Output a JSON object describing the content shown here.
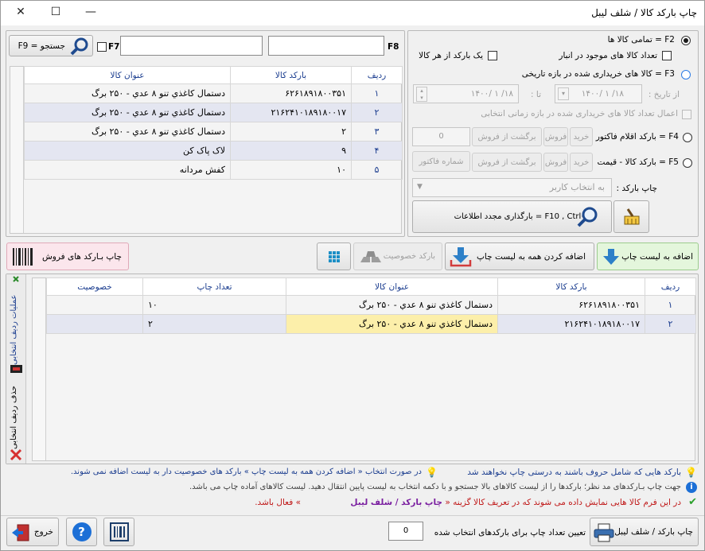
{
  "window": {
    "title": "چاپ بارکد کالا / شلف لیبل"
  },
  "search": {
    "f8_label": "F8",
    "f7_label": "F7",
    "f9_button": "F9 = جستجو",
    "field1_value": "",
    "field2_value": ""
  },
  "top_grid": {
    "headers": [
      "ردیف",
      "بارکد کالا",
      "عنوان کالا"
    ],
    "rows": [
      {
        "idx": "۱",
        "barcode": "۶۲۶۱۸۹۱۸۰۰۳۵۱",
        "title": "دستمال کاغذي تنو ۸ عدي - ۲۵۰ برگ"
      },
      {
        "idx": "۲",
        "barcode": "۲۱۶۲۴۱۰۱۸۹۱۸۰۰۱۷",
        "title": "دستمال کاغذي تنو ۸ عدي - ۲۵۰ برگ"
      },
      {
        "idx": "۳",
        "barcode": "۲",
        "title": "دستمال کاغذي تنو ۸ عدي - ۲۵۰ برگ"
      },
      {
        "idx": "۴",
        "barcode": "۹",
        "title": "لاک پاک کن"
      },
      {
        "idx": "۵",
        "barcode": "۱۰",
        "title": "کفش مردانه"
      }
    ]
  },
  "options": {
    "f2": "F2 = تمامی کالا ها",
    "stock": "تعداد کالا های موجود در انبار",
    "one_per": "یک بارکد از هر کالا",
    "f3": "F3 = کالا های خریداری شده در بازه تاریخی",
    "from_date_label": "از تاریخ :",
    "from_date": "۱۴۰۰/ ۱ /۱۸",
    "to_date_label": "تا :",
    "to_date": "۱۴۰۰/ ۱ /۱۸",
    "apply_count": "اعمال تعداد کالا های خریداری شده در بازه زمانی انتخابی",
    "f4": "F4 = بارکد اقلام فاکتور",
    "f5": "F5 = بارکد کالا - قیمت",
    "buy": "خرید",
    "sell": "فروش",
    "return_sell": "برگشت از فروش",
    "invoice_value": "0",
    "invoice_no": "شماره فاکتور",
    "print_barcode_label": "چاپ بارکد :",
    "user_select": "به انتخاب کاربر",
    "reload": "F10 , Ctrl+F = بارگذاری مجدد اطلاعات"
  },
  "actions": {
    "add_to_list": "اضافه به لیست چاپ",
    "add_all": "اضافه کردن همه به لیست چاپ",
    "special_barcode": "بارکد خصوصیت",
    "print_sales": "چاپ بـارکد های فروش"
  },
  "side": {
    "ops": "عملیات ردیف انتخابی",
    "delete": "حذف ردیف انتخابی"
  },
  "bottom_grid": {
    "headers": [
      "ردیف",
      "بارکد کالا",
      "عنوان کالا",
      "تعداد چاپ",
      "خصوصیت"
    ],
    "rows": [
      {
        "idx": "۱",
        "barcode": "۶۲۶۱۸۹۱۸۰۰۳۵۱",
        "title": "دستمال کاغذي تنو ۸ عدي - ۲۵۰ برگ",
        "count": "۱۰",
        "spec": ""
      },
      {
        "idx": "۲",
        "barcode": "۲۱۶۲۴۱۰۱۸۹۱۸۰۰۱۷",
        "title": "دستمال کاغذي تنو ۸ عدي - ۲۵۰ برگ",
        "count": "۲",
        "spec": ""
      }
    ]
  },
  "hints": {
    "h1": "بارکد هایی که شامل حروف باشند به درستی چاپ نخواهند شد",
    "h1b": "در صورت انتخاب « اضافه کردن همه به لیست چاپ » بارکد های خصوصیت دار به لیست اضافه نمی شوند.",
    "h2": "جهت چاپ بـارکدهای مد نظر؛ بارکدها را از لیست کالاهای بالا جستجو و با دکمه انتخاب به لیست پایین انتقال دهید. لیست کالاهای آماده چاپ می باشد.",
    "h3a": "در این فرم کالا هایی نمایش داده می شوند که در تعریف کالا گزینه «",
    "h3b": "چاپ بارکد / شلف لیبل",
    "h3c": "» فعال باشد."
  },
  "footer": {
    "print": "چاپ بارکد / شلف لیبل",
    "set_count": "تعیین تعداد چاپ برای بارکدهای انتخاب شده",
    "count_value": "0",
    "exit": "خروج"
  },
  "colors": {
    "accent_blue": "#1b3d8f",
    "selected_row": "#e4e6f1",
    "yellow_cell": "#fcefaa",
    "pink_btn": "#fbe6ec",
    "green_btn": "#e4f6dc"
  }
}
